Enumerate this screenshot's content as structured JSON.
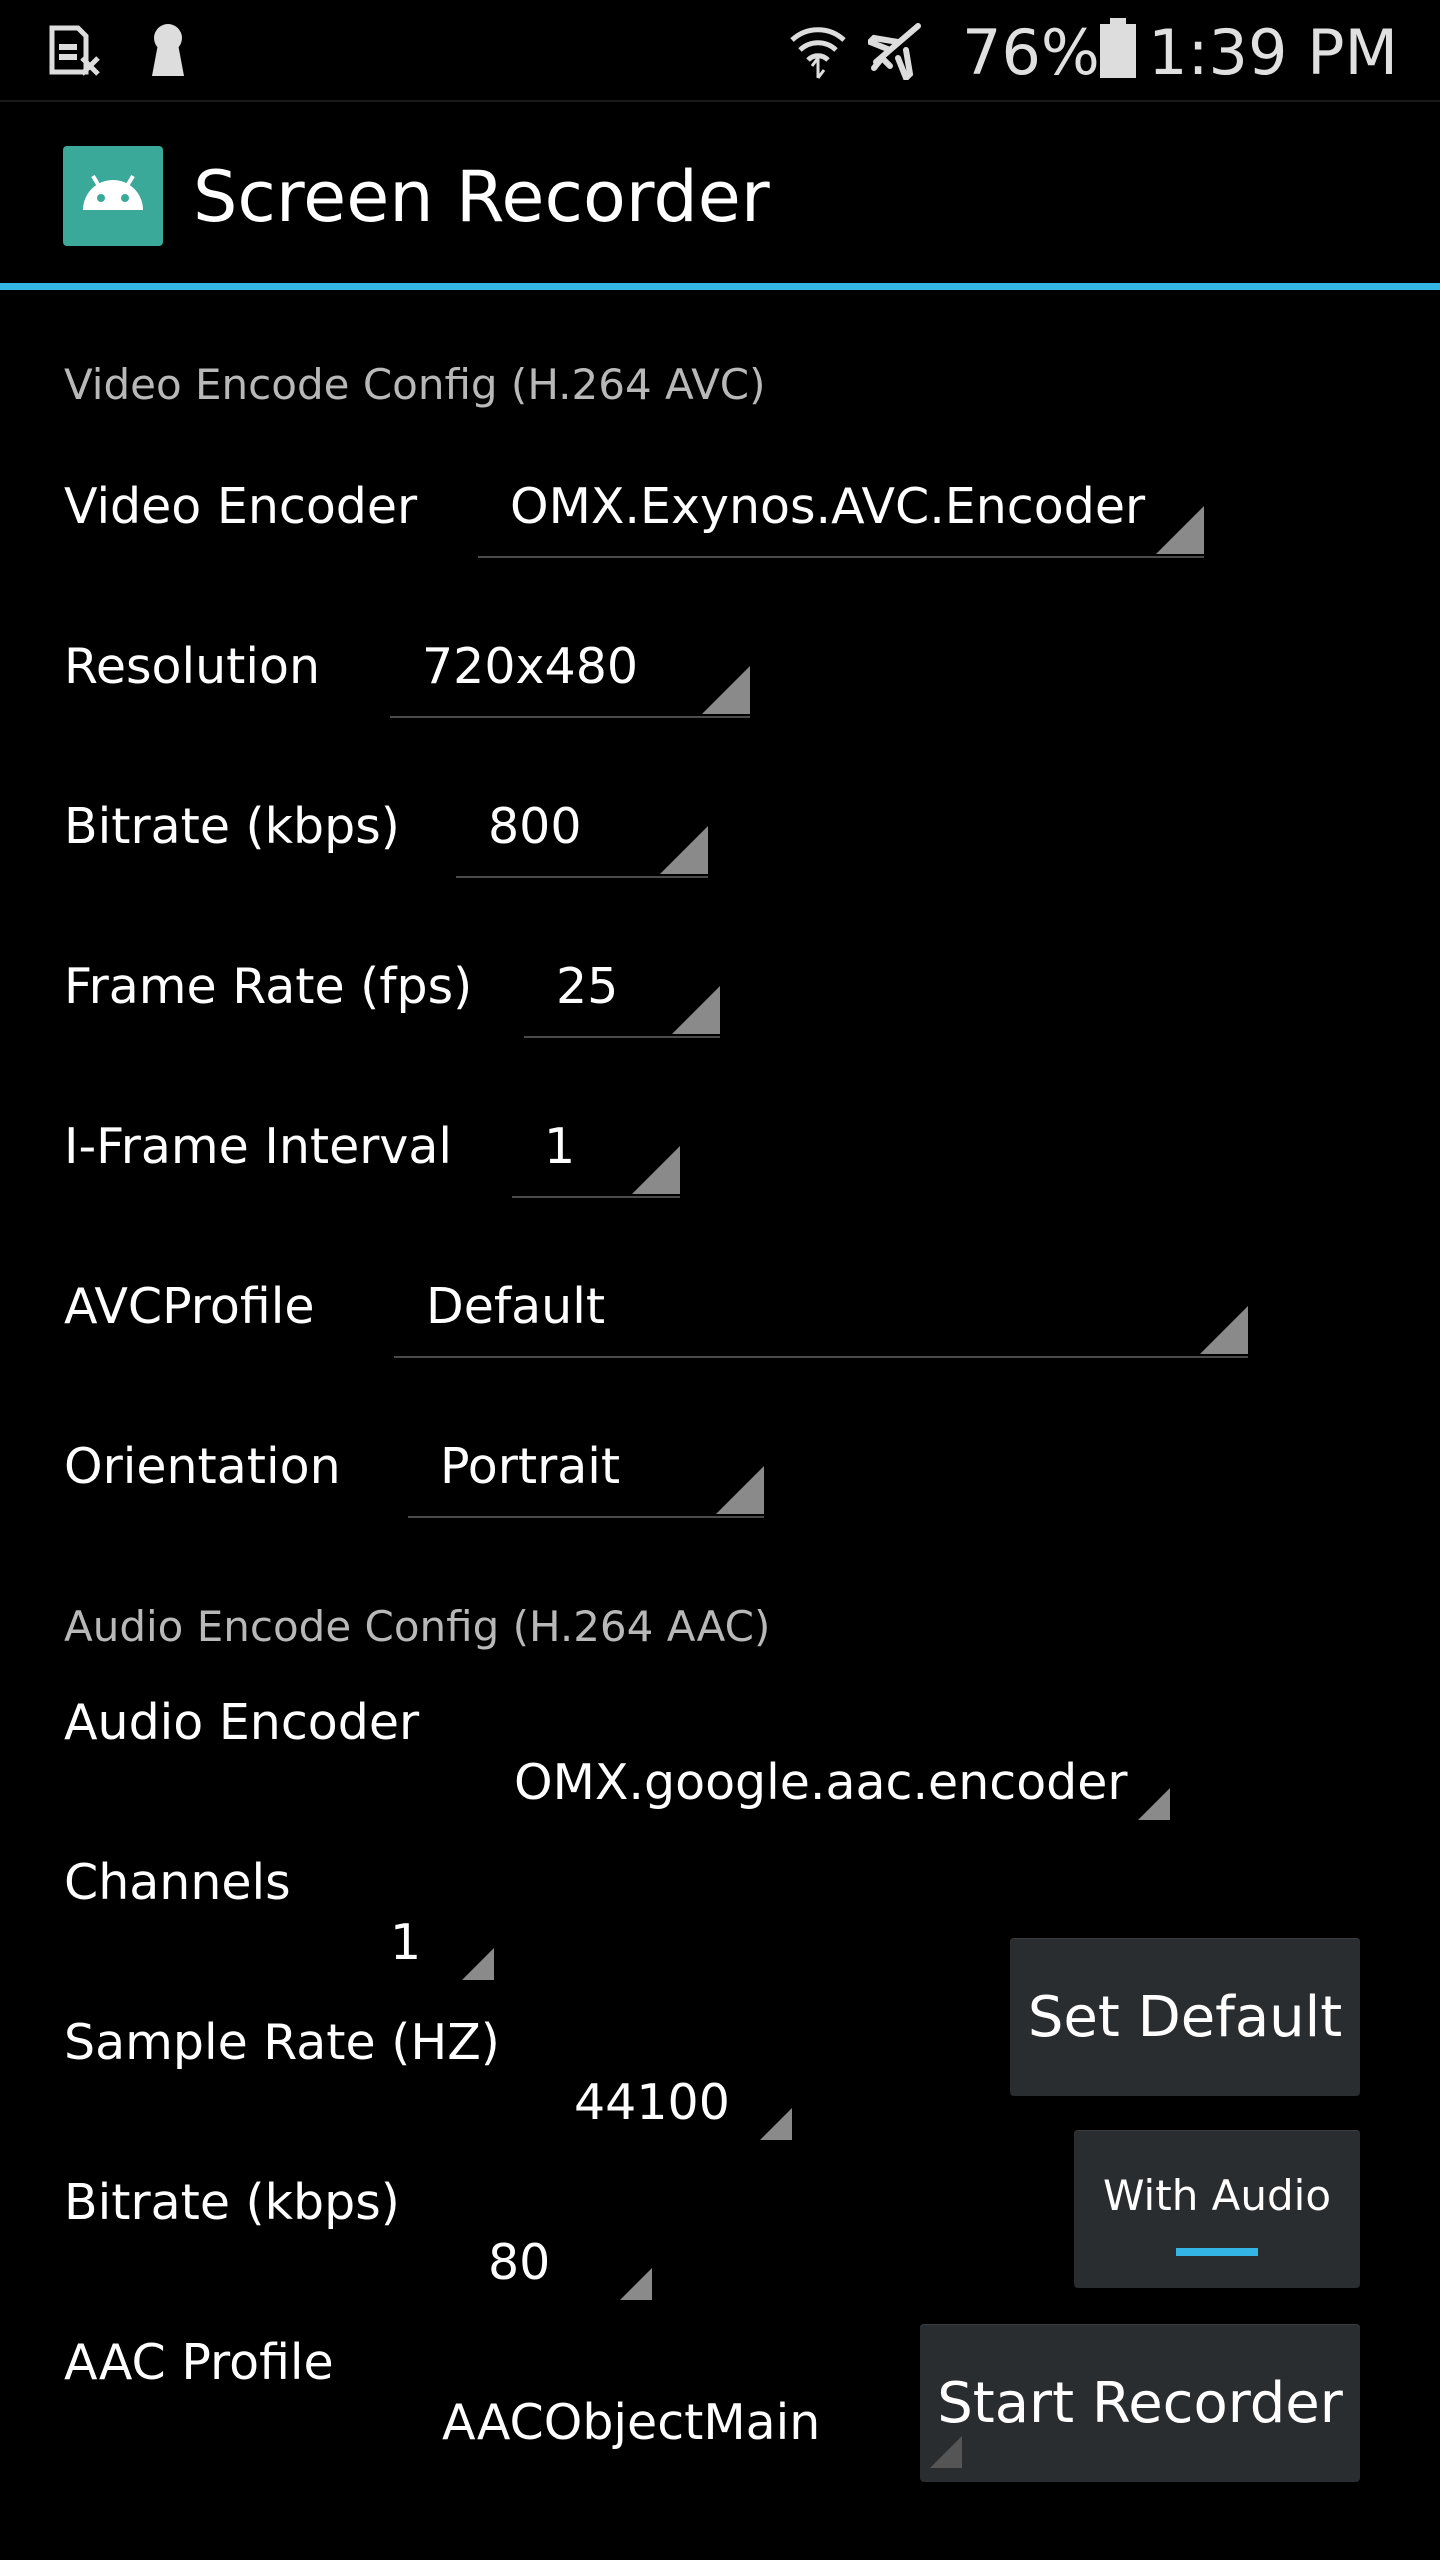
{
  "status_bar": {
    "icons": [
      "sim-card-icon",
      "keyhole-icon",
      "wifi-icon",
      "airplane-icon",
      "battery-icon"
    ],
    "battery": "76%",
    "time": "1:39 PM"
  },
  "app": {
    "title": "Screen Recorder",
    "icon": "android-icon",
    "accent": "#33b5e5"
  },
  "video": {
    "header": "Video Encode Config (H.264 AVC)",
    "encoder_label": "Video Encoder",
    "encoder_value": "OMX.Exynos.AVC.Encoder",
    "resolution_label": "Resolution",
    "resolution_value": "720x480",
    "bitrate_label": "Bitrate (kbps)",
    "bitrate_value": "800",
    "framerate_label": "Frame Rate (fps)",
    "framerate_value": "25",
    "iframe_label": "I-Frame Interval",
    "iframe_value": "1",
    "profile_label": "AVCProfile",
    "profile_value": "Default",
    "orientation_label": "Orientation",
    "orientation_value": "Portrait"
  },
  "audio": {
    "header": "Audio Encode Config (H.264 AAC)",
    "encoder_label": "Audio Encoder",
    "encoder_value": "OMX.google.aac.encoder",
    "channels_label": "Channels",
    "channels_value": "1",
    "samplerate_label": "Sample Rate (HZ)",
    "samplerate_value": "44100",
    "bitrate_label": "Bitrate (kbps)",
    "bitrate_value": "80",
    "profile_label": "AAC Profile",
    "profile_value": "AACObjectMain"
  },
  "buttons": {
    "set_default": "Set Default",
    "with_audio": "With Audio",
    "with_audio_on": true,
    "start": "Start Recorder"
  }
}
